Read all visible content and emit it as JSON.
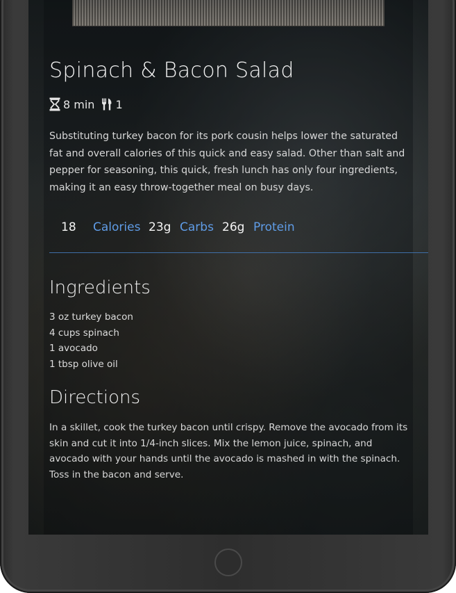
{
  "recipe": {
    "title": "Spinach & Bacon Salad",
    "time": "8 min",
    "servings": "1",
    "description": "Substituting turkey bacon for its pork cousin helps lower the saturated fat and overall calories of this quick and easy salad. Other than salt and pepper for seasoning, this quick, fresh lunch has only four ingredients, making it an easy throw-together meal on busy days.",
    "nutrition": [
      {
        "value": "18",
        "label": "Calories"
      },
      {
        "value": "23g",
        "label": "Carbs"
      },
      {
        "value": "26g",
        "label": "Protein"
      }
    ],
    "ingredients_heading": "Ingredients",
    "ingredients": [
      "3 oz turkey bacon",
      "4 cups spinach",
      "1 avocado",
      "1 tbsp olive oil"
    ],
    "directions_heading": "Directions",
    "directions": "In a skillet, cook the turkey bacon until crispy. Remove the avocado from its skin and cut it into 1/4-inch slices. Mix the lemon juice, spinach, and avocado with your hands until the avocado is mashed in with the spinach. Toss in the bacon and serve."
  },
  "icons": {
    "time": "hourglass-icon",
    "servings": "fork-knife-icon",
    "home": "home-button"
  },
  "colors": {
    "accent": "#5f9ce6",
    "divider": "#3f6fa8",
    "device_frame": "#2e2e2e"
  }
}
